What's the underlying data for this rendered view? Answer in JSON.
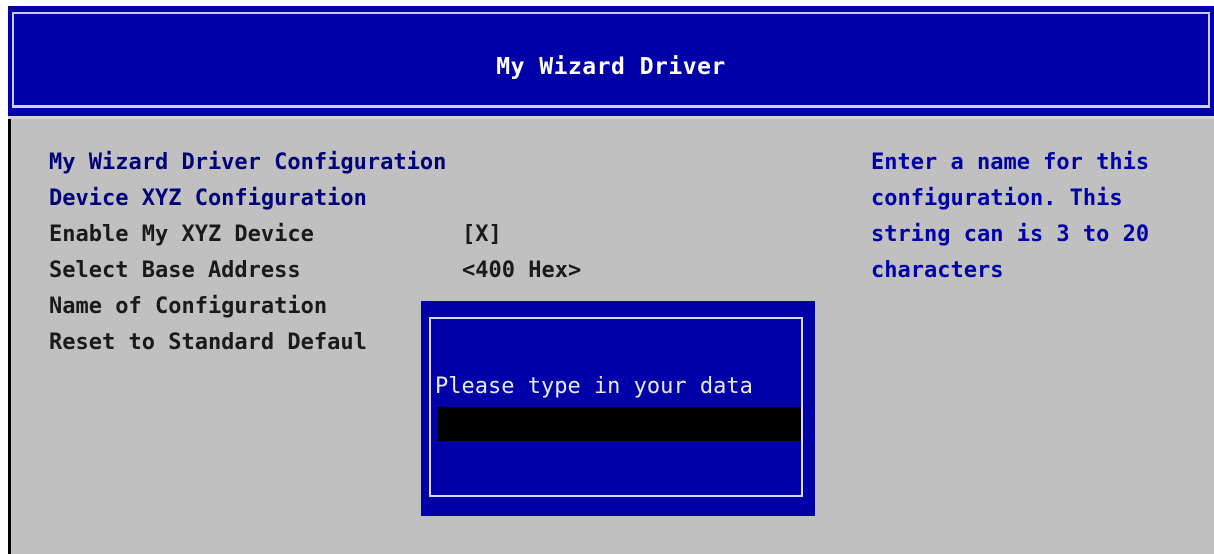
{
  "header": {
    "title": "My Wizard Driver"
  },
  "form": {
    "section_title": "My Wizard Driver Configuration",
    "subsection_title": "Device XYZ Configuration",
    "rows": [
      {
        "label": "Enable My XYZ Device",
        "value": "[X]"
      },
      {
        "label": "Select Base Address",
        "value": "<400 Hex>"
      },
      {
        "label": "Name of Configuration",
        "value": ""
      },
      {
        "label": "Reset to Standard Defaul",
        "value": ""
      }
    ]
  },
  "help": {
    "lines": [
      "Enter a name for this",
      "configuration. This",
      "string can is 3 to 20",
      "characters"
    ]
  },
  "popup": {
    "prompt": "Please type in your data",
    "input_value": ""
  },
  "colors": {
    "header_bg": "#0000a8",
    "body_bg": "#c0c0c0",
    "section_text": "#00007a",
    "input_bg": "#000000"
  }
}
